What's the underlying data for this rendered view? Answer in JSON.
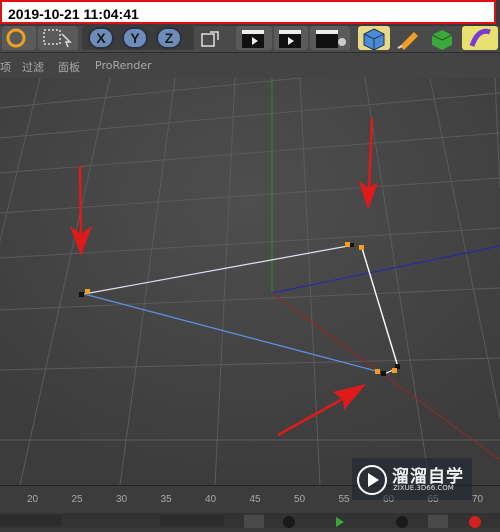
{
  "timestamp": "2019-10-21 11:04:41",
  "toolbar": {
    "axis_x": "X",
    "axis_y": "Y",
    "axis_z": "Z"
  },
  "menu": [
    {
      "label": "项"
    },
    {
      "label": "过滤"
    },
    {
      "label": "面板"
    },
    {
      "label": "ProRender"
    }
  ],
  "timeline": {
    "ticks": [
      "20",
      "25",
      "30",
      "35",
      "40",
      "45",
      "50",
      "55",
      "60",
      "65",
      "70"
    ]
  },
  "watermark": {
    "title": "溜溜自学",
    "subtitle": "ZIXUE.3D66.COM"
  },
  "colors": {
    "spline_white": "#ffffff",
    "spline_blue": "#5a8fe0",
    "axis_green": "#2e8a2e",
    "axis_blue": "#2a2aa8",
    "axis_red": "#8a2a2a",
    "arrow_red": "#e01a1a",
    "point_orange": "#f0a020"
  }
}
